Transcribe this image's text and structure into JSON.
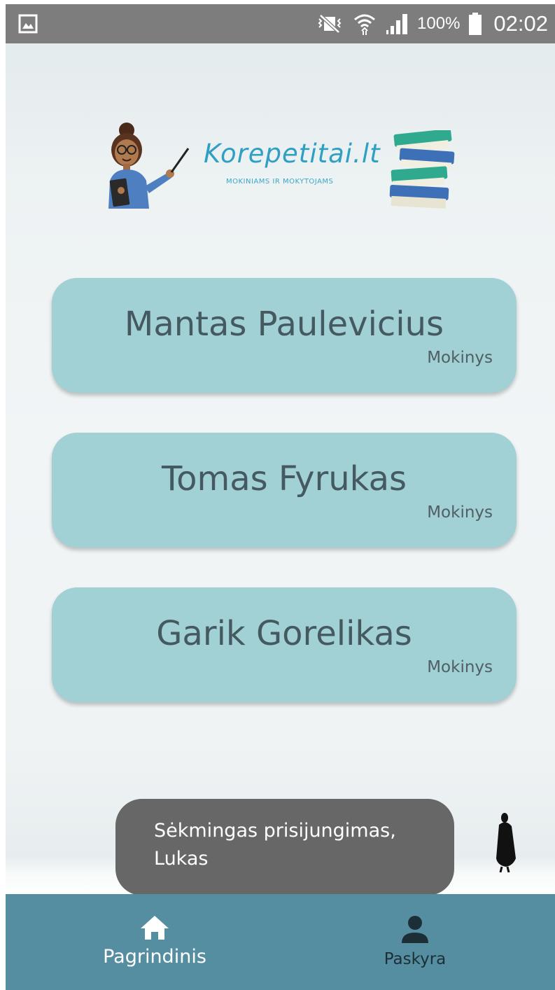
{
  "status_bar": {
    "battery_percent": "100%",
    "time": "02:02",
    "icons": [
      "gallery-notification-icon",
      "mute-vibrate-icon",
      "wifi-icon",
      "signal-icon",
      "battery-icon"
    ]
  },
  "logo": {
    "title": "Korepetitai.lt",
    "subtitle": "MOKINIAMS IR MOKYTOJAMS"
  },
  "students": [
    {
      "name": "Mantas Paulevicius",
      "role": "Mokinys"
    },
    {
      "name": "Tomas Fyrukas",
      "role": "Mokinys"
    },
    {
      "name": "Garik Gorelikas",
      "role": "Mokinys"
    }
  ],
  "toast": {
    "message": "Sėkmingas prisijungimas, Lukas"
  },
  "bottom_nav": {
    "items": [
      {
        "label": "Pagrindinis",
        "icon": "home-icon",
        "active": true
      },
      {
        "label": "Paskyra",
        "icon": "person-icon",
        "active": false
      }
    ]
  },
  "colors": {
    "status_bar": "#7d7d7d",
    "card": "#a1d0d5",
    "card_text": "#455a60",
    "toast": "#676767",
    "bottom_nav": "#568ea1",
    "logo_accent": "#2f9fc4"
  }
}
